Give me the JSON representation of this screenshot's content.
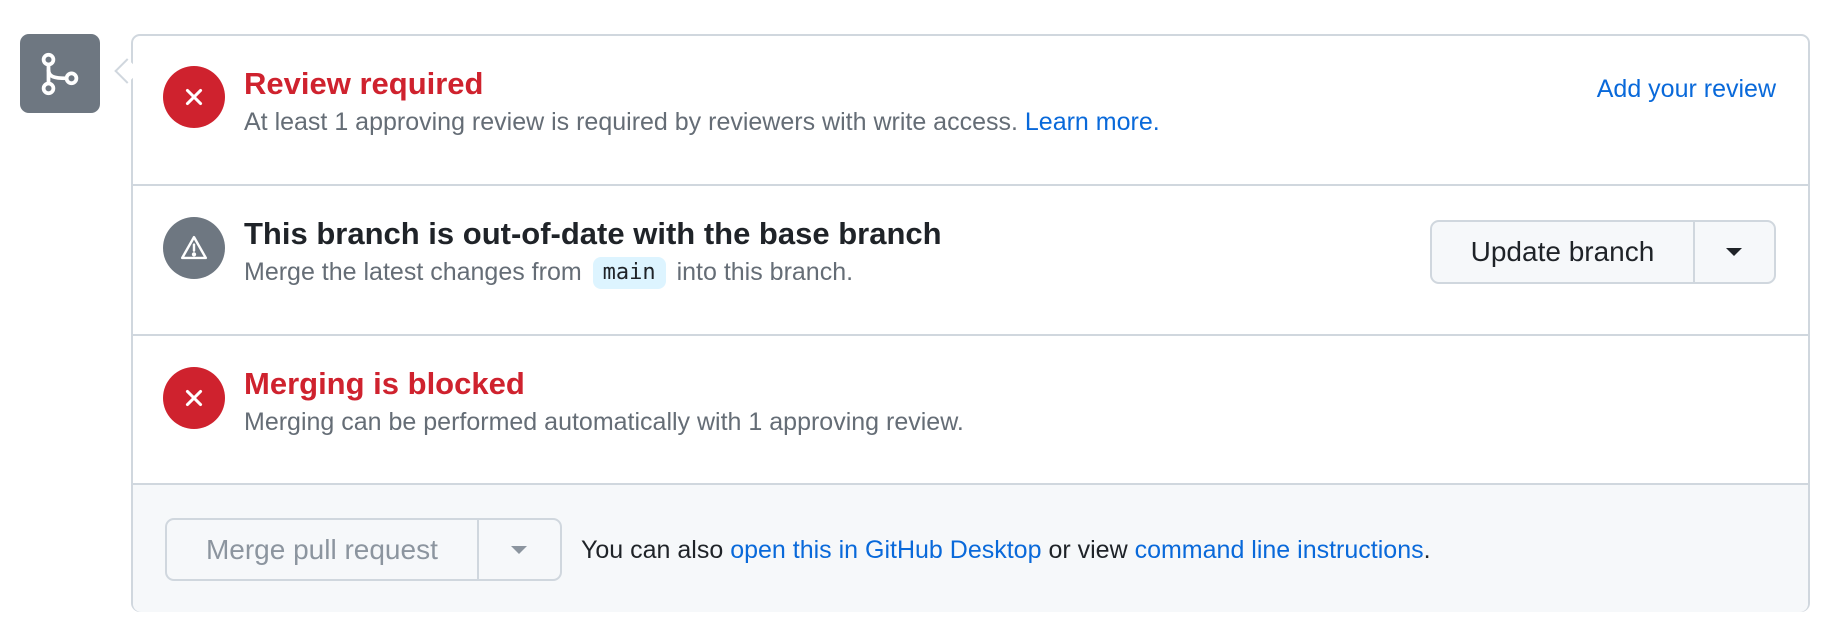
{
  "icons": {
    "merge_badge": "git-branch-icon",
    "review_status": "x-circle-icon",
    "branch_status": "alert-triangle-icon",
    "blocked_status": "x-circle-icon",
    "update_caret": "chevron-down-icon",
    "merge_caret": "chevron-down-icon"
  },
  "colors": {
    "error": "#cf222e",
    "link": "#0969da",
    "neutral_icon": "#6e7781",
    "border": "#d0d7de",
    "footer_bg": "#f6f8fa",
    "code_bg": "#ddf4ff"
  },
  "review": {
    "title": "Review required",
    "description": "At least 1 approving review is required by reviewers with write access.",
    "learn_more": "Learn more.",
    "add_review": "Add your review"
  },
  "branch": {
    "title": "This branch is out-of-date with the base branch",
    "desc_before": "Merge the latest changes from",
    "base_branch": "main",
    "desc_after": "into this branch.",
    "update_button": "Update branch"
  },
  "blocked": {
    "title": "Merging is blocked",
    "description": "Merging can be performed automatically with 1 approving review."
  },
  "footer": {
    "merge_button": "Merge pull request",
    "text_before": "You can also",
    "desktop_link": "open this in GitHub Desktop",
    "text_middle": "or view",
    "cli_link": "command line instructions",
    "text_end": "."
  }
}
